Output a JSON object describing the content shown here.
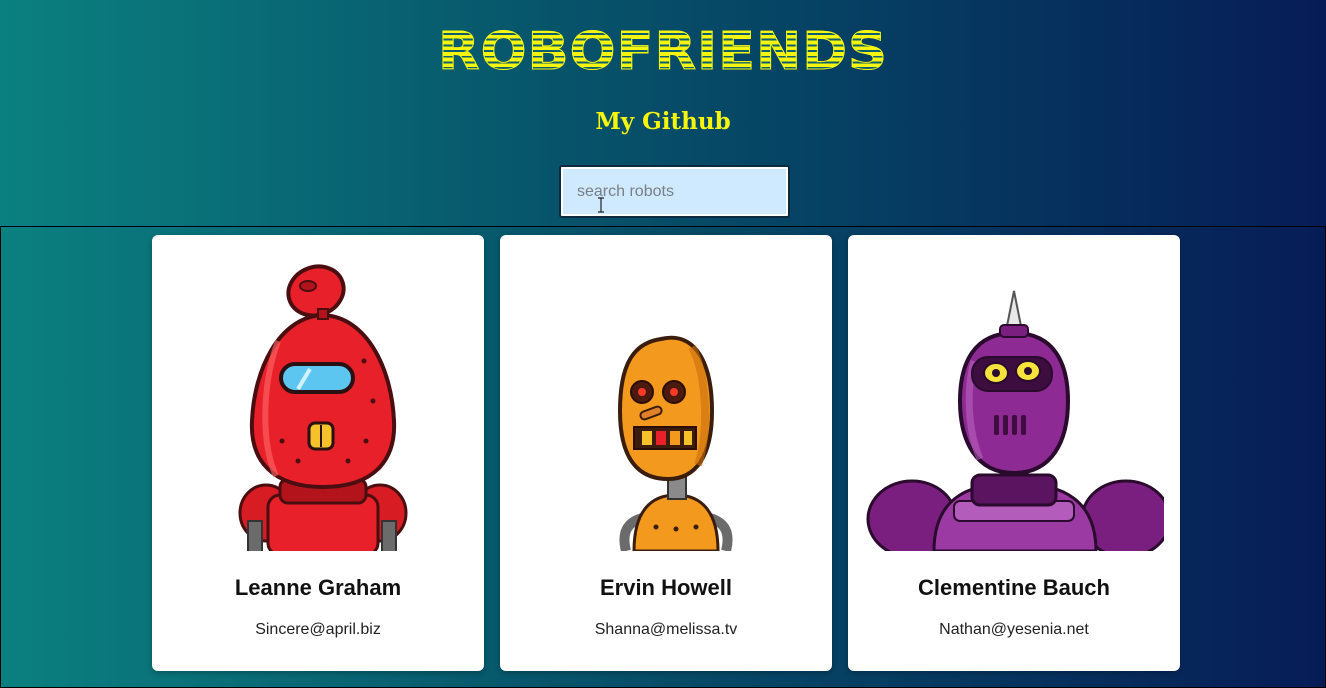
{
  "header": {
    "logo_text": "ROBOFRIENDS",
    "github_link": "My Github",
    "logo_color": "#f5f510"
  },
  "search": {
    "placeholder": "search robots",
    "value": "",
    "background": "#cfeaff"
  },
  "cards": [
    {
      "name": "Leanne Graham",
      "email": "Sincere@april.biz",
      "robot_color": "#e8202a",
      "robot": "red-dome-robot"
    },
    {
      "name": "Ervin Howell",
      "email": "Shanna@melissa.tv",
      "robot_color": "#f39a1e",
      "robot": "orange-oval-robot"
    },
    {
      "name": "Clementine Bauch",
      "email": "Nathan@yesenia.net",
      "robot_color": "#8e2a93",
      "robot": "purple-horned-robot"
    }
  ]
}
